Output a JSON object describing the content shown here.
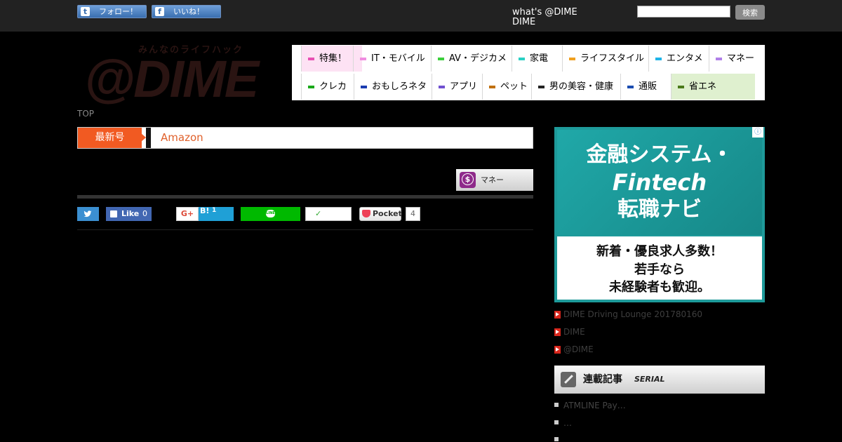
{
  "topbar": {
    "follow_label": "フォロー！",
    "like_label": "いいね！",
    "whats_line1": "what's @DIME",
    "whats_line2": "DIME",
    "search_placeholder": "",
    "search_button": "検索"
  },
  "logo": {
    "tagline": "みんなのライフハック",
    "text": "@DIME"
  },
  "nav": {
    "row1": [
      {
        "label": "特集！",
        "color": "#e84fb3"
      },
      {
        "label": "IT・モバイル",
        "color": "#f08ce0"
      },
      {
        "label": "AV・デジカメ",
        "color": "#3ccf3c"
      },
      {
        "label": "家電",
        "color": "#2ad0c4"
      },
      {
        "label": "ライフスタイル",
        "color": "#f0a020"
      },
      {
        "label": "エンタメ",
        "color": "#1fb4e8"
      },
      {
        "label": "マネー",
        "color": "#b080e8"
      }
    ],
    "row2": [
      {
        "label": "クレカ",
        "color": "#1aa81a"
      },
      {
        "label": "おもしろネタ",
        "color": "#1a3cb0"
      },
      {
        "label": "アプリ",
        "color": "#7050d0"
      },
      {
        "label": "ペット",
        "color": "#c07010"
      },
      {
        "label": "男の美容・健康",
        "color": "#222222"
      },
      {
        "label": "通販",
        "color": "#1a4cb0"
      },
      {
        "label": "省エネ",
        "color": "#4a7a1a"
      }
    ]
  },
  "breadcrumb": "TOP",
  "latest": {
    "label": "最新号",
    "link": "Amazon"
  },
  "category_tag": {
    "icon": "dollar-icon",
    "symbol": "$",
    "label": "マネー"
  },
  "share": {
    "fb_label": "Like",
    "fb_count": "0",
    "gplus_label": "G+",
    "hatena_label": "B!",
    "hatena_count": "1",
    "line_label": "LINE",
    "check_mark": "✓",
    "pocket_label": "Pocket",
    "pocket_count": "4"
  },
  "ad": {
    "title1": "金融システム・",
    "title2": "Fintech",
    "title3": "転職ナビ",
    "sub1": "新着・優良求人多数！",
    "sub2": "若手なら",
    "sub3": "未経験者も歓迎。",
    "info": "ⓘ"
  },
  "sidebar_links": [
    "DIME Driving Lounge 201780160",
    "DIME",
    "@DIME"
  ],
  "serial": {
    "title": "連載記事",
    "subtitle": "SERIAL",
    "items": [
      "ATMLINE Pay…",
      "…",
      ""
    ]
  },
  "colors": {
    "accent": "#f15a22",
    "topbar": "#222222",
    "ad_teal": "#1e9a9a"
  }
}
